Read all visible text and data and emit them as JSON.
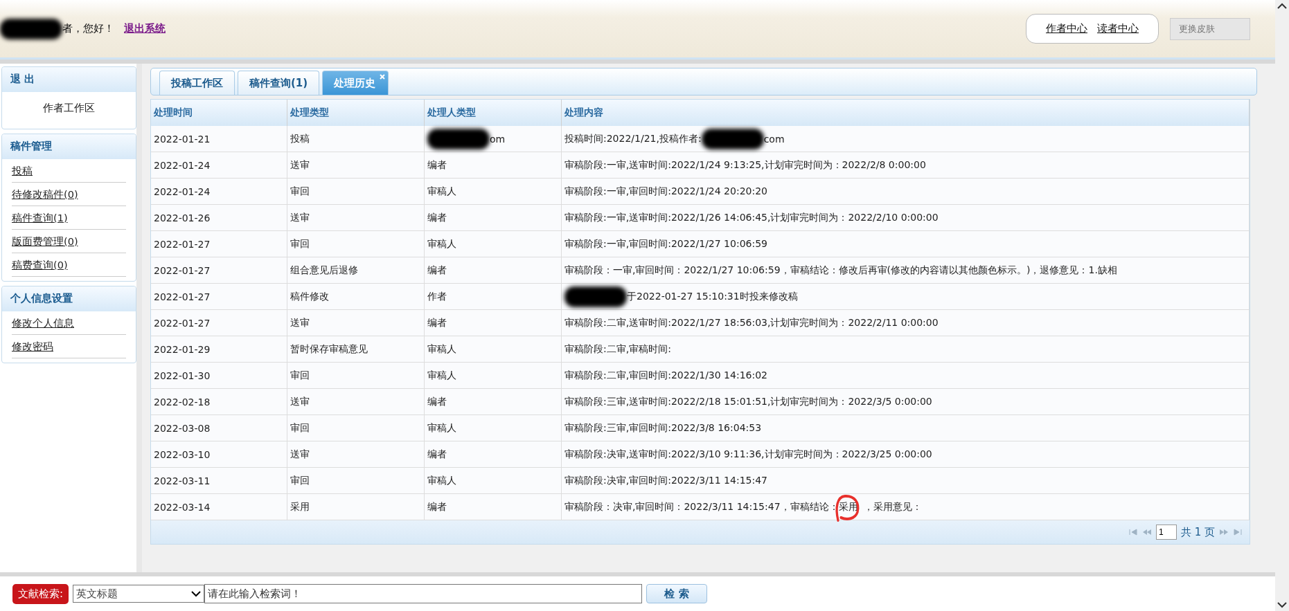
{
  "header": {
    "greeting": [
      {
        "kind": "redacted"
      },
      {
        "kind": "text",
        "text": "者，您好！"
      }
    ],
    "logout_link": "退出系统",
    "links": [
      "作者中心",
      "读者中心"
    ],
    "skin_button": "更换皮肤"
  },
  "sidebar": {
    "sections": [
      {
        "title": "退 出",
        "items": [
          {
            "label": "作者工作区",
            "kind": "center"
          }
        ]
      },
      {
        "title": "稿件管理",
        "items": [
          {
            "label": "投稿",
            "kind": "link"
          },
          {
            "label": "待修改稿件(0)",
            "kind": "link"
          },
          {
            "label": "稿件查询(1)",
            "kind": "link"
          },
          {
            "label": "版面费管理(0)",
            "kind": "link"
          },
          {
            "label": "稿费查询(0)",
            "kind": "link"
          }
        ]
      },
      {
        "title": "个人信息设置",
        "items": [
          {
            "label": "修改个人信息",
            "kind": "link"
          },
          {
            "label": "修改密码",
            "kind": "link"
          }
        ]
      }
    ]
  },
  "tabs": [
    {
      "label": "投稿工作区",
      "selected": false,
      "closable": false
    },
    {
      "label": "稿件查询(1)",
      "selected": false,
      "closable": false
    },
    {
      "label": "处理历史",
      "selected": true,
      "closable": true
    }
  ],
  "table": {
    "columns": [
      "处理时间",
      "处理类型",
      "处理人类型",
      "处理内容"
    ],
    "rows": [
      [
        [
          {
            "kind": "text",
            "text": "2022-01-21"
          }
        ],
        [
          {
            "kind": "text",
            "text": "投稿"
          }
        ],
        [
          {
            "kind": "redacted"
          },
          {
            "kind": "text",
            "text": "om"
          }
        ],
        [
          {
            "kind": "text",
            "text": "投稿时间:2022/1/21,投稿作者:"
          },
          {
            "kind": "redacted"
          },
          {
            "kind": "text",
            "text": "com"
          }
        ]
      ],
      [
        [
          {
            "kind": "text",
            "text": "2022-01-24"
          }
        ],
        [
          {
            "kind": "text",
            "text": "送审"
          }
        ],
        [
          {
            "kind": "text",
            "text": "编者"
          }
        ],
        [
          {
            "kind": "text",
            "text": "审稿阶段:一审,送审时间:2022/1/24 9:13:25,计划审完时间为：2022/2/8 0:00:00"
          }
        ]
      ],
      [
        [
          {
            "kind": "text",
            "text": "2022-01-24"
          }
        ],
        [
          {
            "kind": "text",
            "text": "审回"
          }
        ],
        [
          {
            "kind": "text",
            "text": "审稿人"
          }
        ],
        [
          {
            "kind": "text",
            "text": "审稿阶段:一审,审回时间:2022/1/24 20:20:20"
          }
        ]
      ],
      [
        [
          {
            "kind": "text",
            "text": "2022-01-26"
          }
        ],
        [
          {
            "kind": "text",
            "text": "送审"
          }
        ],
        [
          {
            "kind": "text",
            "text": "编者"
          }
        ],
        [
          {
            "kind": "text",
            "text": "审稿阶段:一审,送审时间:2022/1/26 14:06:45,计划审完时间为：2022/2/10 0:00:00"
          }
        ]
      ],
      [
        [
          {
            "kind": "text",
            "text": "2022-01-27"
          }
        ],
        [
          {
            "kind": "text",
            "text": "审回"
          }
        ],
        [
          {
            "kind": "text",
            "text": "审稿人"
          }
        ],
        [
          {
            "kind": "text",
            "text": "审稿阶段:一审,审回时间:2022/1/27 10:06:59"
          }
        ]
      ],
      [
        [
          {
            "kind": "text",
            "text": "2022-01-27"
          }
        ],
        [
          {
            "kind": "text",
            "text": "组合意见后退修"
          }
        ],
        [
          {
            "kind": "text",
            "text": "编者"
          }
        ],
        [
          {
            "kind": "text",
            "text": "审稿阶段：一审,审回时间：2022/1/27 10:06:59，审稿结论：修改后再审(修改的内容请以其他颜色标示。)，退修意见：1.缺相"
          }
        ]
      ],
      [
        [
          {
            "kind": "text",
            "text": "2022-01-27"
          }
        ],
        [
          {
            "kind": "text",
            "text": "稿件修改"
          }
        ],
        [
          {
            "kind": "text",
            "text": "作者"
          }
        ],
        [
          {
            "kind": "redacted"
          },
          {
            "kind": "text",
            "text": "于2022-01-27 15:10:31时投来修改稿"
          }
        ]
      ],
      [
        [
          {
            "kind": "text",
            "text": "2022-01-27"
          }
        ],
        [
          {
            "kind": "text",
            "text": "送审"
          }
        ],
        [
          {
            "kind": "text",
            "text": "编者"
          }
        ],
        [
          {
            "kind": "text",
            "text": "审稿阶段:二审,送审时间:2022/1/27 18:56:03,计划审完时间为：2022/2/11 0:00:00"
          }
        ]
      ],
      [
        [
          {
            "kind": "text",
            "text": "2022-01-29"
          }
        ],
        [
          {
            "kind": "text",
            "text": "暂时保存审稿意见"
          }
        ],
        [
          {
            "kind": "text",
            "text": "审稿人"
          }
        ],
        [
          {
            "kind": "text",
            "text": "审稿阶段:二审,审稿时间:"
          }
        ]
      ],
      [
        [
          {
            "kind": "text",
            "text": "2022-01-30"
          }
        ],
        [
          {
            "kind": "text",
            "text": "审回"
          }
        ],
        [
          {
            "kind": "text",
            "text": "审稿人"
          }
        ],
        [
          {
            "kind": "text",
            "text": "审稿阶段:二审,审回时间:2022/1/30 14:16:02"
          }
        ]
      ],
      [
        [
          {
            "kind": "text",
            "text": "2022-02-18"
          }
        ],
        [
          {
            "kind": "text",
            "text": "送审"
          }
        ],
        [
          {
            "kind": "text",
            "text": "编者"
          }
        ],
        [
          {
            "kind": "text",
            "text": "审稿阶段:三审,送审时间:2022/2/18 15:01:51,计划审完时间为：2022/3/5 0:00:00"
          }
        ]
      ],
      [
        [
          {
            "kind": "text",
            "text": "2022-03-08"
          }
        ],
        [
          {
            "kind": "text",
            "text": "审回"
          }
        ],
        [
          {
            "kind": "text",
            "text": "审稿人"
          }
        ],
        [
          {
            "kind": "text",
            "text": "审稿阶段:三审,审回时间:2022/3/8 16:04:53"
          }
        ]
      ],
      [
        [
          {
            "kind": "text",
            "text": "2022-03-10"
          }
        ],
        [
          {
            "kind": "text",
            "text": "送审"
          }
        ],
        [
          {
            "kind": "text",
            "text": "编者"
          }
        ],
        [
          {
            "kind": "text",
            "text": "审稿阶段:决审,送审时间:2022/3/10 9:11:36,计划审完时间为：2022/3/25 0:00:00"
          }
        ]
      ],
      [
        [
          {
            "kind": "text",
            "text": "2022-03-11"
          }
        ],
        [
          {
            "kind": "text",
            "text": "审回"
          }
        ],
        [
          {
            "kind": "text",
            "text": "审稿人"
          }
        ],
        [
          {
            "kind": "text",
            "text": "审稿阶段:决审,审回时间:2022/3/11 14:15:47"
          }
        ]
      ],
      [
        [
          {
            "kind": "text",
            "text": "2022-03-14"
          }
        ],
        [
          {
            "kind": "text",
            "text": "采用"
          }
        ],
        [
          {
            "kind": "text",
            "text": "编者"
          }
        ],
        [
          {
            "kind": "text",
            "text": "审稿阶段：决审,审回时间：2022/3/11 14:15:47，审稿结论："
          },
          {
            "kind": "circled",
            "text": "采用"
          },
          {
            "kind": "text",
            "text": "，采用意见："
          }
        ]
      ]
    ]
  },
  "pager": {
    "page": "1",
    "total": "共 1 页"
  },
  "search": {
    "label": "文献检索:",
    "field_select": "英文标题",
    "placeholder": "请在此输入检索词！",
    "button": "检 索"
  },
  "annotation": {
    "color": "#e8302c"
  }
}
